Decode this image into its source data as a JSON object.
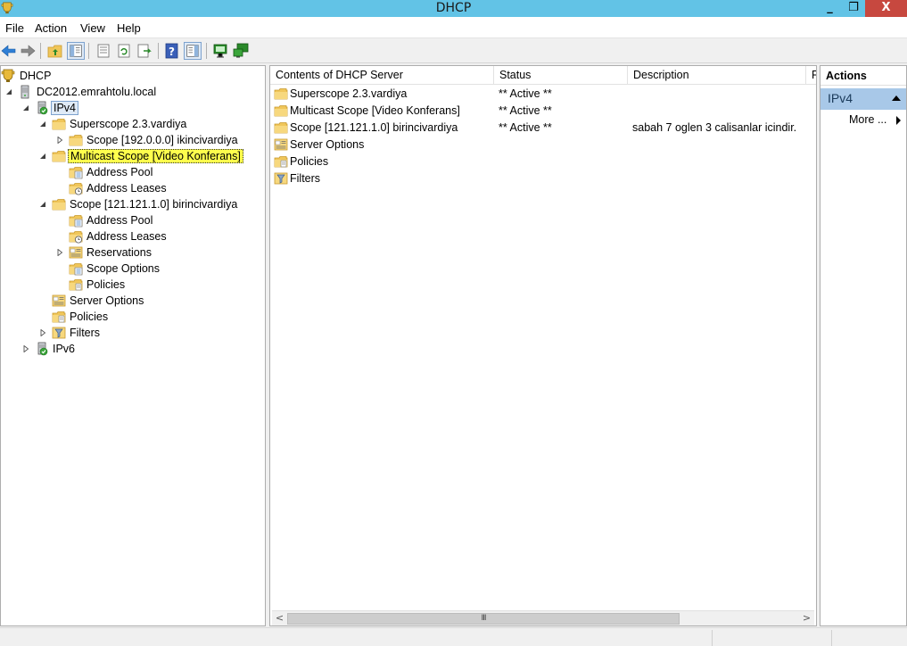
{
  "window": {
    "title": "DHCP",
    "min": "_",
    "max": "❐",
    "close": "X"
  },
  "menu": [
    "File",
    "Action",
    "View",
    "Help"
  ],
  "tree": {
    "root": "DHCP",
    "server": "DC2012.emrahtolu.local",
    "ipv4": "IPv4",
    "superscope": "Superscope 2.3.vardiya",
    "scope_192": "Scope [192.0.0.0] ikincivardiya",
    "multicast": "Multicast Scope [Video Konferans]",
    "mc_address_pool": "Address Pool",
    "mc_address_leases": "Address Leases",
    "scope_121": "Scope [121.121.1.0] birincivardiya",
    "s121_address_pool": "Address Pool",
    "s121_address_leases": "Address Leases",
    "s121_reservations": "Reservations",
    "s121_scope_options": "Scope Options",
    "s121_policies": "Policies",
    "server_options": "Server Options",
    "policies": "Policies",
    "filters": "Filters",
    "ipv6": "IPv6"
  },
  "list": {
    "columns": [
      "Contents of DHCP Server",
      "Status",
      "Description",
      "F"
    ],
    "rows": [
      {
        "name": "Superscope 2.3.vardiya",
        "status": "** Active **",
        "description": "",
        "icon": "folder-icon"
      },
      {
        "name": "Multicast Scope [Video Konferans]",
        "status": "** Active **",
        "description": "",
        "icon": "folder-icon"
      },
      {
        "name": "Scope [121.121.1.0] birincivardiya",
        "status": "** Active **",
        "description": "sabah 7 oglen 3 calisanlar icindir.",
        "icon": "folder-icon"
      },
      {
        "name": "Server Options",
        "status": "",
        "description": "",
        "icon": "options-icon"
      },
      {
        "name": "Policies",
        "status": "",
        "description": "",
        "icon": "policies-icon"
      },
      {
        "name": "Filters",
        "status": "",
        "description": "",
        "icon": "filter-icon"
      }
    ]
  },
  "actions": {
    "title": "Actions",
    "section": "IPv4",
    "more": "More ..."
  },
  "scroll": {
    "left": "<",
    "right": ">",
    "grip": "III"
  },
  "colors": {
    "titlebar": "#62c3e6",
    "close": "#c7483f",
    "highlight": "#ffff4d",
    "section": "#a8c8e8"
  }
}
